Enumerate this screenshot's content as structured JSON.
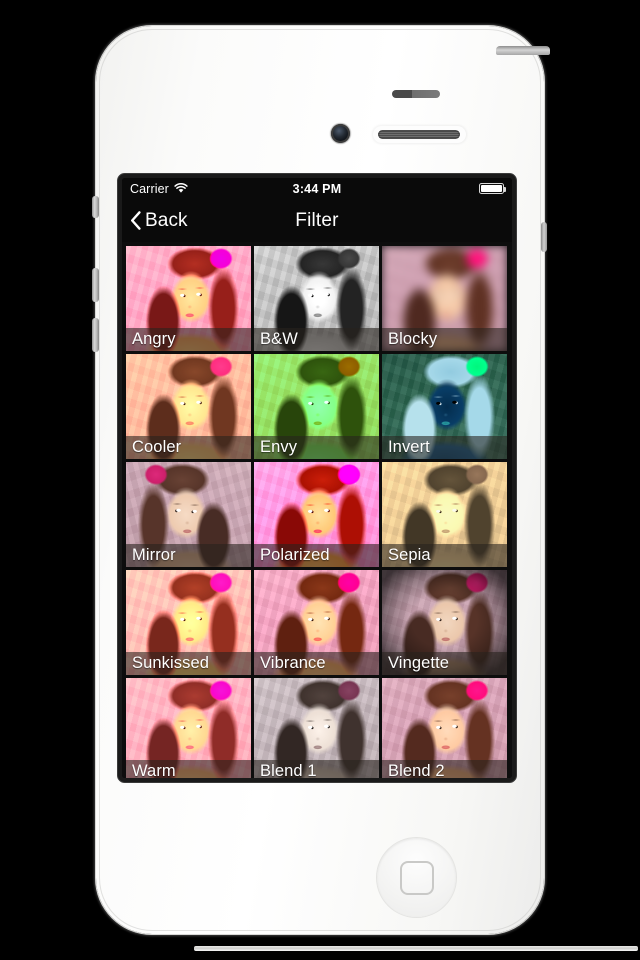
{
  "device": {
    "type": "smartphone-white",
    "hardware": {
      "power_button": "power-button",
      "volume_up": "volume-up-button",
      "volume_down": "volume-down-button",
      "mute_switch": "mute-switch",
      "home_button": "home-button",
      "front_camera": "front-camera",
      "earpiece": "earpiece-speaker",
      "proximity_sensor": "proximity-sensor"
    }
  },
  "status_bar": {
    "carrier": "Carrier",
    "wifi_icon": "wifi-icon",
    "time": "3:44 PM",
    "battery_icon": "battery-full-icon",
    "battery_level": 100,
    "background": "#0a0a0a",
    "foreground": "#ffffff"
  },
  "nav_bar": {
    "back_icon": "chevron-left-icon",
    "back_label": "Back",
    "title": "Filter",
    "background": "#0a0a0a",
    "foreground": "#ffffff"
  },
  "grid": {
    "columns": 3,
    "background": "#0d0d0d",
    "label_overlay_color": "rgba(40,34,30,0.58)",
    "label_text_color": "#ffffff",
    "tiles": [
      {
        "label": "Angry",
        "effect": "fx-angry",
        "row": 1,
        "col": 1
      },
      {
        "label": "B&W",
        "effect": "fx-bw",
        "row": 1,
        "col": 2
      },
      {
        "label": "Blocky",
        "effect": "fx-blocky",
        "row": 1,
        "col": 3
      },
      {
        "label": "Cooler",
        "effect": "fx-cooler",
        "row": 2,
        "col": 1
      },
      {
        "label": "Envy",
        "effect": "fx-envy",
        "row": 2,
        "col": 2
      },
      {
        "label": "Invert",
        "effect": "fx-invert",
        "row": 2,
        "col": 3
      },
      {
        "label": "Mirror",
        "effect": "fx-mirror",
        "row": 3,
        "col": 1
      },
      {
        "label": "Polarized",
        "effect": "fx-polarized",
        "row": 3,
        "col": 2
      },
      {
        "label": "Sepia",
        "effect": "fx-sepia",
        "row": 3,
        "col": 3
      },
      {
        "label": "Sunkissed",
        "effect": "fx-sunkissed",
        "row": 4,
        "col": 1
      },
      {
        "label": "Vibrance",
        "effect": "fx-vibrance",
        "row": 4,
        "col": 2
      },
      {
        "label": "Vingette",
        "effect": "fx-vingette",
        "row": 4,
        "col": 3
      },
      {
        "label": "Warm",
        "effect": "fx-warm",
        "row": 5,
        "col": 1
      },
      {
        "label": "Blend 1",
        "effect": "fx-blend1",
        "row": 5,
        "col": 2
      },
      {
        "label": "Blend 2",
        "effect": "fx-blend2",
        "row": 5,
        "col": 3
      }
    ]
  }
}
